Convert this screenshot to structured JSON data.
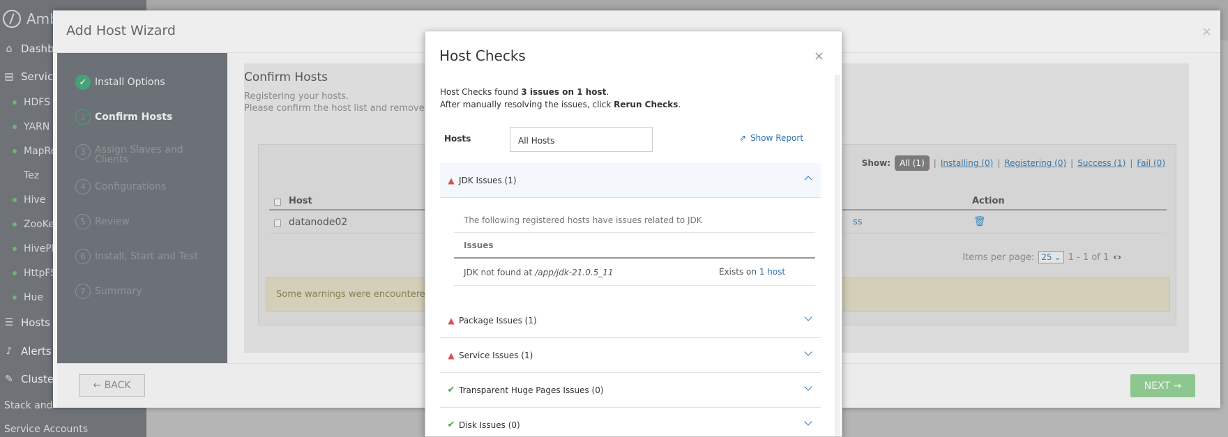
{
  "app": {
    "logo_text": "Amb",
    "nav": {
      "dashboard": "Dashbo",
      "services": "Service",
      "hosts": "Hosts",
      "alerts": "Alerts",
      "cluster": "Cluster"
    },
    "services": [
      "HDFS",
      "YARN",
      "MapRe",
      "Tez",
      "Hive",
      "ZooKe",
      "HivePlu",
      "HttpFS",
      "Hue"
    ],
    "cluster_sub": [
      "Stack and",
      "Service Accounts"
    ]
  },
  "wizard": {
    "title": "Add Host Wizard",
    "close_glyph": "×",
    "steps": [
      {
        "num": "✓",
        "label": "Install Options"
      },
      {
        "num": "2",
        "label": "Confirm Hosts"
      },
      {
        "num": "3",
        "label": "Assign Slaves and Clients"
      },
      {
        "num": "4",
        "label": "Configurations"
      },
      {
        "num": "5",
        "label": "Review"
      },
      {
        "num": "6",
        "label": "Install, Start and Test"
      },
      {
        "num": "7",
        "label": "Summary"
      }
    ],
    "confirm": {
      "title": "Confirm Hosts",
      "sub1": "Registering your hosts.",
      "sub2": "Please confirm the host list and remove any hos",
      "show_label": "Show:",
      "filters": {
        "all": "All (1)",
        "installing": "Installing (0)",
        "registering": "Registering (0)",
        "success": "Success (1)",
        "fail": "Fail (0)"
      },
      "sep": "|",
      "col_host": "Host",
      "col_action": "Action",
      "row_host": "datanode02",
      "row_status": "ss",
      "items_per_page_label": "Items per page:",
      "items_per_page_value": "25",
      "page_range": "1 - 1 of 1",
      "warning": "Some warnings were encountered while"
    },
    "back_label": "← BACK",
    "next_label": "NEXT →"
  },
  "host_checks": {
    "title": "Host Checks",
    "close_glyph": "×",
    "summary_prefix": "Host Checks found ",
    "summary_bold": "3 issues on 1 host",
    "summary_suffix": ".",
    "resolve_prefix": "After manually resolving the issues, click ",
    "resolve_bold": "Rerun Checks",
    "resolve_suffix": ".",
    "hosts_label": "Hosts",
    "hosts_select": "All Hosts",
    "show_report": "Show Report",
    "sections": {
      "jdk": "JDK Issues (1)",
      "package": "Package Issues (1)",
      "service": "Service Issues (1)",
      "thp": "Transparent Huge Pages Issues (0)",
      "disk": "Disk Issues (0)"
    },
    "jdk_detail": {
      "description": "The following registered hosts have issues related to JDK",
      "col_issues": "Issues",
      "issue_prefix": "JDK not found at",
      "issue_path": "/app/jdk-21.0.5_11",
      "exists_prefix": "Exists on ",
      "exists_link": "1 host"
    }
  }
}
